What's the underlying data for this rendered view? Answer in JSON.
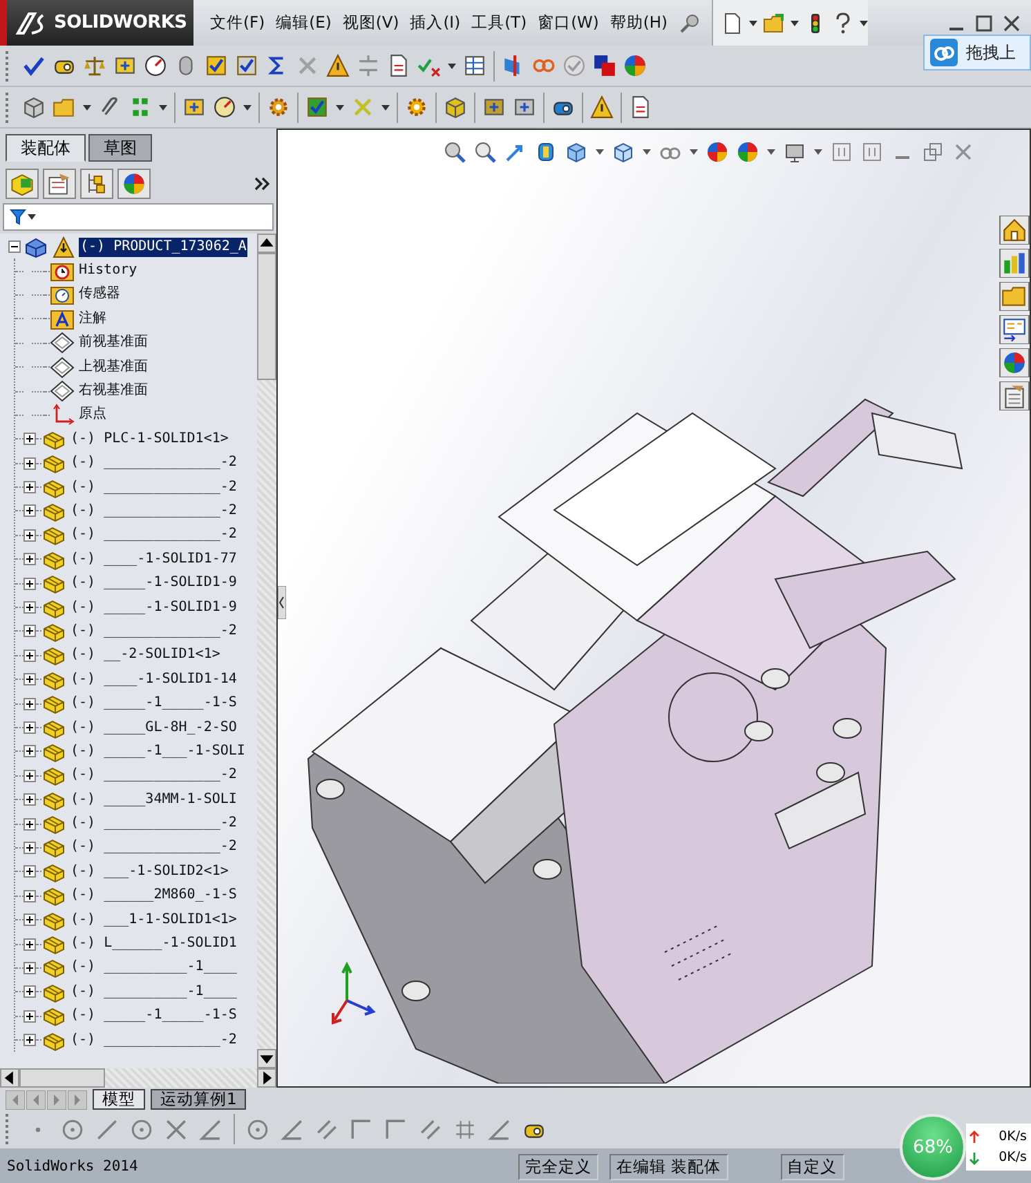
{
  "app": {
    "logo": "SOLIDWORKS"
  },
  "menu": [
    "文件(F)",
    "编辑(E)",
    "视图(V)",
    "插入(I)",
    "工具(T)",
    "窗口(W)",
    "帮助(H)"
  ],
  "popup": {
    "label": "拖拽上"
  },
  "panel_tabs": [
    {
      "label": "装配体",
      "selected": true
    },
    {
      "label": "草图",
      "selected": false
    }
  ],
  "tree": {
    "root": {
      "label": "(-) PRODUCT_173062_A",
      "selected": true,
      "expanded": true,
      "warning": true,
      "children": [
        {
          "kind": "history",
          "label": "History"
        },
        {
          "kind": "sensor",
          "label": "传感器"
        },
        {
          "kind": "annotation",
          "label": "注解"
        },
        {
          "kind": "plane",
          "label": "前视基准面"
        },
        {
          "kind": "plane",
          "label": "上视基准面"
        },
        {
          "kind": "plane",
          "label": "右视基准面"
        },
        {
          "kind": "origin",
          "label": "原点"
        },
        {
          "kind": "part",
          "label": "(-) PLC-1-SOLID1<1>",
          "expanded": false
        },
        {
          "kind": "part",
          "label": "(-) ______________-2",
          "expanded": false
        },
        {
          "kind": "part",
          "label": "(-) ______________-2",
          "expanded": false
        },
        {
          "kind": "part",
          "label": "(-) ______________-2",
          "expanded": false
        },
        {
          "kind": "part",
          "label": "(-) ______________-2",
          "expanded": false
        },
        {
          "kind": "part",
          "label": "(-) ____-1-SOLID1-77",
          "expanded": false
        },
        {
          "kind": "part",
          "label": "(-) _____-1-SOLID1-9",
          "expanded": false
        },
        {
          "kind": "part",
          "label": "(-) _____-1-SOLID1-9",
          "expanded": false
        },
        {
          "kind": "part",
          "label": "(-) ______________-2",
          "expanded": false
        },
        {
          "kind": "part",
          "label": "(-) __-2-SOLID1<1>",
          "expanded": false
        },
        {
          "kind": "part",
          "label": "(-) ____-1-SOLID1-14",
          "expanded": false
        },
        {
          "kind": "part",
          "label": "(-) _____-1_____-1-S",
          "expanded": false
        },
        {
          "kind": "part",
          "label": "(-) _____GL-8H_-2-SO",
          "expanded": false
        },
        {
          "kind": "part",
          "label": "(-) _____-1___-1-SOLI",
          "expanded": false
        },
        {
          "kind": "part",
          "label": "(-) ______________-2",
          "expanded": false
        },
        {
          "kind": "part",
          "label": "(-) _____34MM-1-SOLI",
          "expanded": false
        },
        {
          "kind": "part",
          "label": "(-) ______________-2",
          "expanded": false
        },
        {
          "kind": "part",
          "label": "(-) ______________-2",
          "expanded": false
        },
        {
          "kind": "part",
          "label": "(-) ___-1-SOLID2<1>",
          "expanded": false
        },
        {
          "kind": "part",
          "label": "(-) ______2M860_-1-S",
          "expanded": false
        },
        {
          "kind": "part",
          "label": "(-) ___1-1-SOLID1<1>",
          "expanded": false
        },
        {
          "kind": "part",
          "label": "(-) L______-1-SOLID1",
          "expanded": false
        },
        {
          "kind": "part",
          "label": "(-) __________-1____",
          "expanded": false
        },
        {
          "kind": "part",
          "label": "(-) __________-1____",
          "expanded": false
        },
        {
          "kind": "part",
          "label": "(-) _____-1_____-1-S",
          "expanded": false
        },
        {
          "kind": "part",
          "label": "(-) ______________-2",
          "expanded": false
        }
      ]
    }
  },
  "bottom_tabs": [
    {
      "label": "模型",
      "selected": true
    },
    {
      "label": "运动算例1",
      "selected": false
    }
  ],
  "status_bar": {
    "app_name": "SolidWorks 2014",
    "fields": [
      "完全定义",
      "在编辑 装配体",
      "自定义"
    ]
  },
  "network_widget": {
    "percent": "68%",
    "upload": "0K/s",
    "download": "0K/s"
  }
}
